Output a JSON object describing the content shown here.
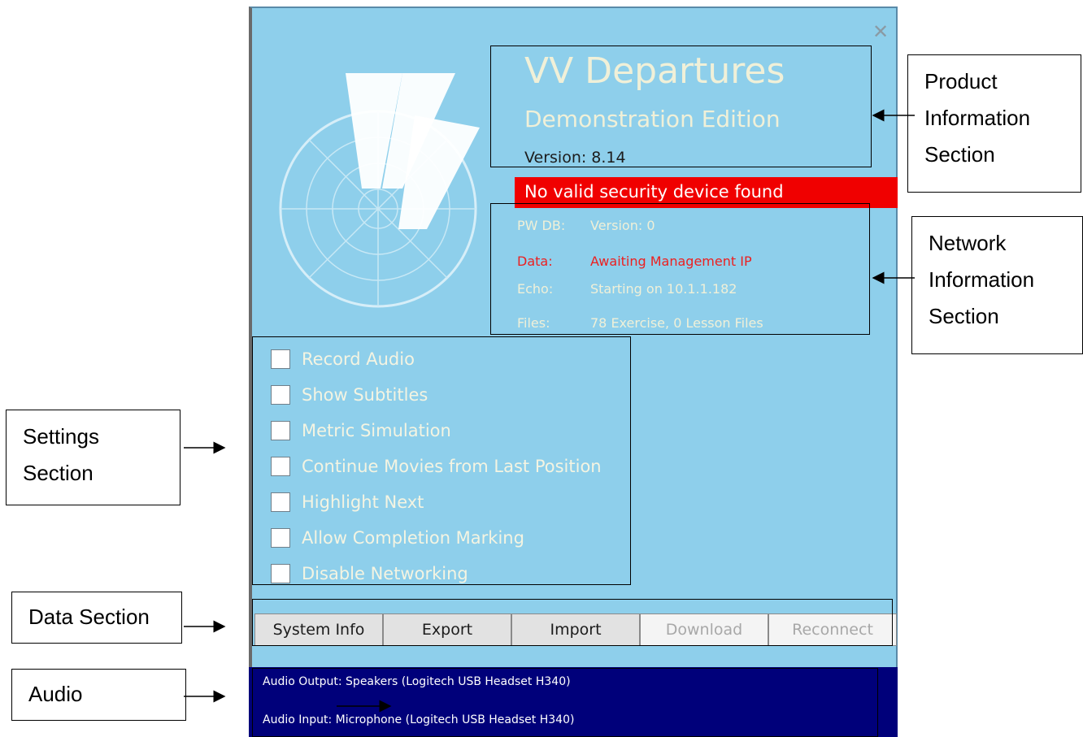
{
  "app": {
    "close_icon": "close-icon",
    "logo_icon": "vv-radar-logo",
    "title": "VV Departures",
    "subtitle": "Demonstration Edition",
    "version": "Version: 8.14",
    "alert": "No valid security device found"
  },
  "network": [
    {
      "key": "PW DB:",
      "value": "Version: 0"
    },
    {
      "key": "Data:",
      "value": "Awaiting Management IP"
    },
    {
      "key": "Echo:",
      "value": "Starting on 10.1.1.182"
    },
    {
      "key": "Files:",
      "value": "78 Exercise, 0 Lesson Files"
    }
  ],
  "settings": [
    "Record Audio",
    "Show Subtitles",
    "Metric Simulation",
    "Continue Movies from Last Position",
    "Highlight Next",
    "Allow Completion Marking",
    "Disable Networking"
  ],
  "buttons": [
    {
      "label": "System Info",
      "enabled": true
    },
    {
      "label": "Export",
      "enabled": true
    },
    {
      "label": "Import",
      "enabled": true
    },
    {
      "label": "Download",
      "enabled": false
    },
    {
      "label": "Reconnect",
      "enabled": false
    }
  ],
  "audio": {
    "output": "Audio Output: Speakers (Logitech USB Headset H340)",
    "input": "Audio Input: Microphone (Logitech USB Headset H340)"
  },
  "annotations": {
    "product": [
      "Product",
      "Information",
      "Section"
    ],
    "network": [
      "Network",
      "Information",
      "Section"
    ],
    "settings": [
      "Settings",
      "Section"
    ],
    "data": [
      "Data Section"
    ],
    "audio": [
      "Audio"
    ]
  },
  "colors": {
    "window_bg": "#8ecfeb",
    "alert_bg": "#f00000",
    "audio_bg": "#00007a",
    "error_text": "#ec2020"
  }
}
